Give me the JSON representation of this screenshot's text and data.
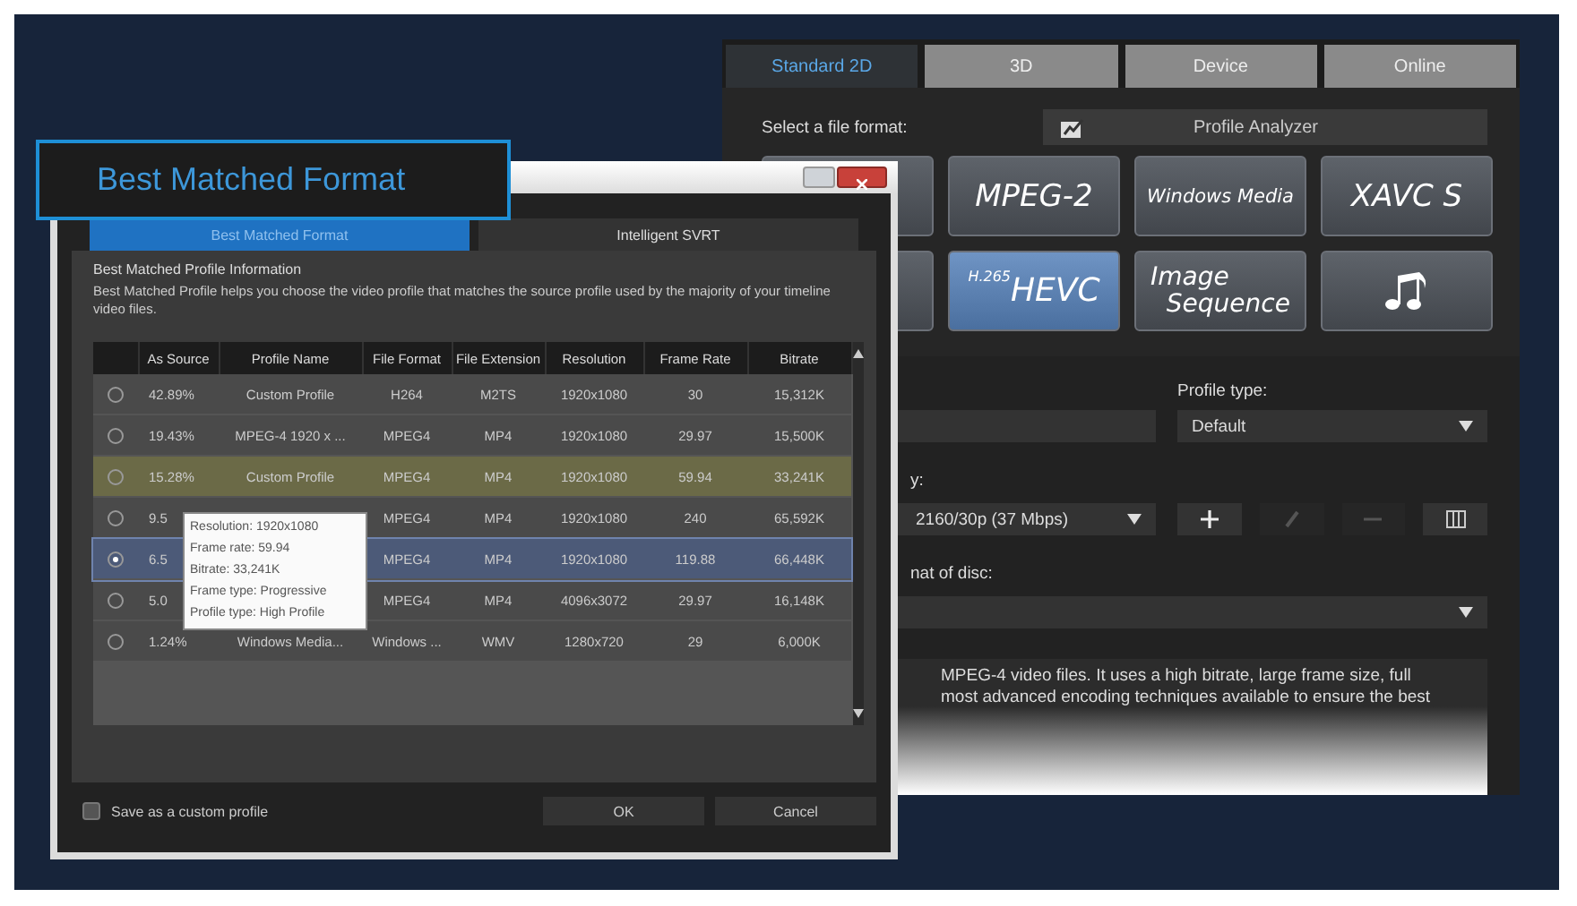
{
  "background_window": {
    "tabs": [
      {
        "label": "Standard 2D",
        "selected": true
      },
      {
        "label": "3D",
        "selected": false
      },
      {
        "label": "Device",
        "selected": false
      },
      {
        "label": "Online",
        "selected": false
      }
    ],
    "format_prompt": "Select a file format:",
    "profile_analyzer": "Profile Analyzer",
    "format_tiles": [
      {
        "kind": "plain",
        "selected": false
      },
      {
        "kind": "text",
        "label": "MPEG-2",
        "selected": false
      },
      {
        "kind": "small-text",
        "label": "Windows Media",
        "selected": false
      },
      {
        "kind": "text",
        "label": "XAVC S",
        "selected": false
      },
      {
        "kind": "plain",
        "selected": false
      },
      {
        "kind": "hevc",
        "sup": "H.265",
        "label": "HEVC",
        "selected": true
      },
      {
        "kind": "two-line",
        "lines": [
          "Image",
          "Sequence"
        ],
        "selected": false
      },
      {
        "kind": "audio",
        "selected": false
      }
    ],
    "profile_type_label": "Profile type:",
    "profile_type_value": "Default",
    "quality_label": "y:",
    "quality_value": "2160/30p (37 Mbps)",
    "disc_label": "nat of disc:",
    "description_lines": [
      "MPEG-4 video files. It uses a high bitrate, large frame size, full",
      "most advanced encoding techniques available to ensure the best"
    ]
  },
  "callout": "Best Matched Format",
  "dialog": {
    "tabs": [
      {
        "label": "Best Matched Format",
        "selected": true
      },
      {
        "label": "Intelligent SVRT",
        "selected": false
      }
    ],
    "heading": "Best Matched Profile Information",
    "description": "Best Matched Profile helps you choose the video profile that matches the source profile used by the majority of your timeline video files.",
    "table": {
      "columns": [
        "As Source",
        "Profile Name",
        "File Format",
        "File Extension",
        "Resolution",
        "Frame Rate",
        "Bitrate"
      ],
      "rows": [
        {
          "selected": false,
          "highlighted": false,
          "cells": [
            "42.89%",
            "Custom Profile",
            "H264",
            "M2TS",
            "1920x1080",
            "30",
            "15,312K"
          ]
        },
        {
          "selected": false,
          "highlighted": false,
          "cells": [
            "19.43%",
            "MPEG-4 1920 x ...",
            "MPEG4",
            "MP4",
            "1920x1080",
            "29.97",
            "15,500K"
          ]
        },
        {
          "selected": false,
          "highlighted": true,
          "cells": [
            "15.28%",
            "Custom Profile",
            "MPEG4",
            "MP4",
            "1920x1080",
            "59.94",
            "33,241K"
          ]
        },
        {
          "selected": false,
          "highlighted": false,
          "cells": [
            "9.5",
            null,
            "MPEG4",
            "MP4",
            "1920x1080",
            "240",
            "65,592K"
          ]
        },
        {
          "selected": true,
          "highlighted": false,
          "cells": [
            "6.5",
            null,
            "MPEG4",
            "MP4",
            "1920x1080",
            "119.88",
            "66,448K"
          ]
        },
        {
          "selected": false,
          "highlighted": false,
          "cells": [
            "5.0",
            null,
            "MPEG4",
            "MP4",
            "4096x3072",
            "29.97",
            "16,148K"
          ]
        },
        {
          "selected": false,
          "highlighted": false,
          "cells": [
            "1.24%",
            "Windows Media...",
            "Windows ...",
            "WMV",
            "1280x720",
            "29",
            "6,000K"
          ]
        }
      ]
    },
    "tooltip": [
      "Resolution: 1920x1080",
      "Frame rate: 59.94",
      "Bitrate: 33,241K",
      "Frame type: Progressive",
      "Profile type: High Profile"
    ],
    "save_custom": {
      "label": "Save as a custom profile",
      "checked": false
    },
    "buttons": [
      "OK",
      "Cancel"
    ]
  }
}
